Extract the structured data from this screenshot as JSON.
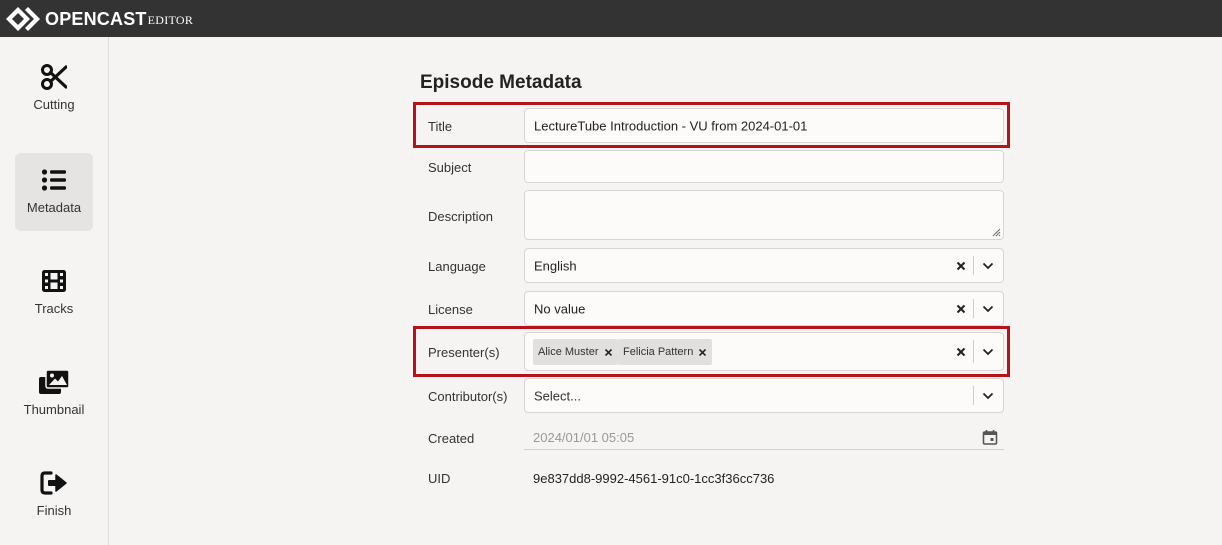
{
  "app": {
    "logo_text": "OPENCAST",
    "logo_sub": "EDITOR"
  },
  "sidebar": {
    "items": [
      {
        "label": "Cutting",
        "icon": "scissors-icon",
        "active": false
      },
      {
        "label": "Metadata",
        "icon": "list-icon",
        "active": true
      },
      {
        "label": "Tracks",
        "icon": "film-icon",
        "active": false
      },
      {
        "label": "Thumbnail",
        "icon": "images-icon",
        "active": false
      },
      {
        "label": "Finish",
        "icon": "sign-out-icon",
        "active": false
      }
    ]
  },
  "metadata": {
    "heading": "Episode Metadata",
    "title": {
      "label": "Title",
      "value": "LectureTube Introduction - VU from 2024-01-01"
    },
    "subject": {
      "label": "Subject",
      "value": ""
    },
    "description": {
      "label": "Description",
      "value": ""
    },
    "language": {
      "label": "Language",
      "value": "English"
    },
    "license": {
      "label": "License",
      "value": "No value"
    },
    "presenters": {
      "label": "Presenter(s)",
      "values": [
        "Alice Muster",
        "Felicia Pattern"
      ]
    },
    "contributors": {
      "label": "Contributor(s)",
      "placeholder": "Select..."
    },
    "created": {
      "label": "Created",
      "value": "2024/01/01 05:05"
    },
    "uid": {
      "label": "UID",
      "value": "9e837dd8-9992-4561-91c0-1cc3f36cc736"
    }
  },
  "colors": {
    "topbar": "#333333",
    "highlight": "#b5121b",
    "background": "#f6f4f3"
  }
}
